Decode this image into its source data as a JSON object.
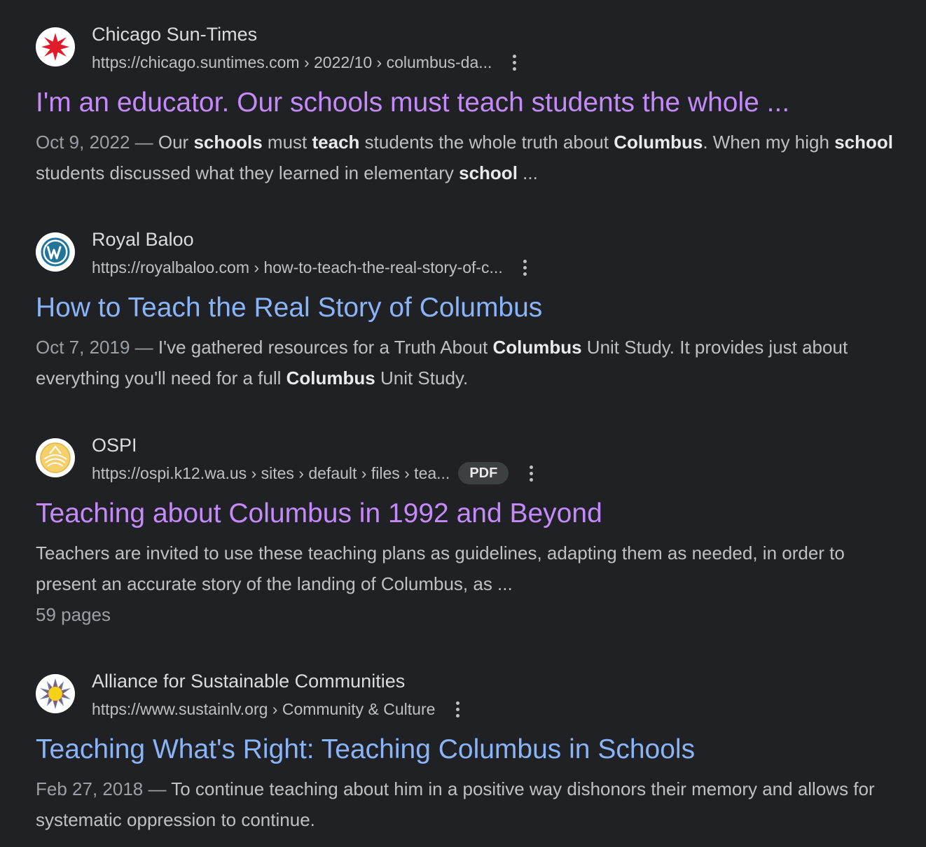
{
  "results": [
    {
      "site_name": "Chicago Sun-Times",
      "favicon": "chicago-star-icon",
      "url": "https://chicago.suntimes.com › 2022/10 › columbus-da...",
      "title": "I'm an educator. Our schools must teach students the whole ...",
      "visited": true,
      "date": "Oct 9, 2022",
      "date_sep": " — ",
      "snippet_parts": [
        {
          "t": "Our ",
          "b": false
        },
        {
          "t": "schools",
          "b": true
        },
        {
          "t": " must ",
          "b": false
        },
        {
          "t": "teach",
          "b": true
        },
        {
          "t": " students the whole truth about ",
          "b": false
        },
        {
          "t": "Columbus",
          "b": true
        },
        {
          "t": ". When my high ",
          "b": false
        },
        {
          "t": "school",
          "b": true
        },
        {
          "t": " students discussed what they learned in elementary ",
          "b": false
        },
        {
          "t": "school",
          "b": true
        },
        {
          "t": " ...",
          "b": false
        }
      ]
    },
    {
      "site_name": "Royal Baloo",
      "favicon": "wordpress-icon",
      "url": "https://royalbaloo.com › how-to-teach-the-real-story-of-c...",
      "title": "How to Teach the Real Story of Columbus",
      "visited": false,
      "date": "Oct 7, 2019",
      "date_sep": " — ",
      "snippet_parts": [
        {
          "t": "I've gathered resources for a Truth About ",
          "b": false
        },
        {
          "t": "Columbus",
          "b": true
        },
        {
          "t": " Unit Study. It provides just about everything you'll need for a full ",
          "b": false
        },
        {
          "t": "Columbus",
          "b": true
        },
        {
          "t": " Unit Study.",
          "b": false
        }
      ]
    },
    {
      "site_name": "OSPI",
      "favicon": "ospi-logo-icon",
      "url": "https://ospi.k12.wa.us › sites › default › files › tea...",
      "badge": "PDF",
      "title": "Teaching about Columbus in 1992 and Beyond",
      "visited": true,
      "snippet_parts": [
        {
          "t": "Teachers are invited to use these teaching plans as guidelines, adapting them as needed, in order to present an accurate story of the landing of Columbus, as ...",
          "b": false
        }
      ],
      "meta": "59 pages"
    },
    {
      "site_name": "Alliance for Sustainable Communities",
      "favicon": "sun-logo-icon",
      "url": "https://www.sustainlv.org › Community & Culture",
      "title": "Teaching What's Right: Teaching Columbus in Schools",
      "visited": false,
      "date": "Feb 27, 2018",
      "date_sep": " — ",
      "snippet_parts": [
        {
          "t": "To continue teaching about him in a positive way dishonors their memory and allows for systematic oppression to continue.",
          "b": false
        }
      ]
    }
  ],
  "colors": {
    "background": "#202124",
    "visited_link": "#c58af9",
    "unvisited_link": "#8ab4f8",
    "snippet_text": "#bdc1c6",
    "date_text": "#9aa0a6"
  }
}
